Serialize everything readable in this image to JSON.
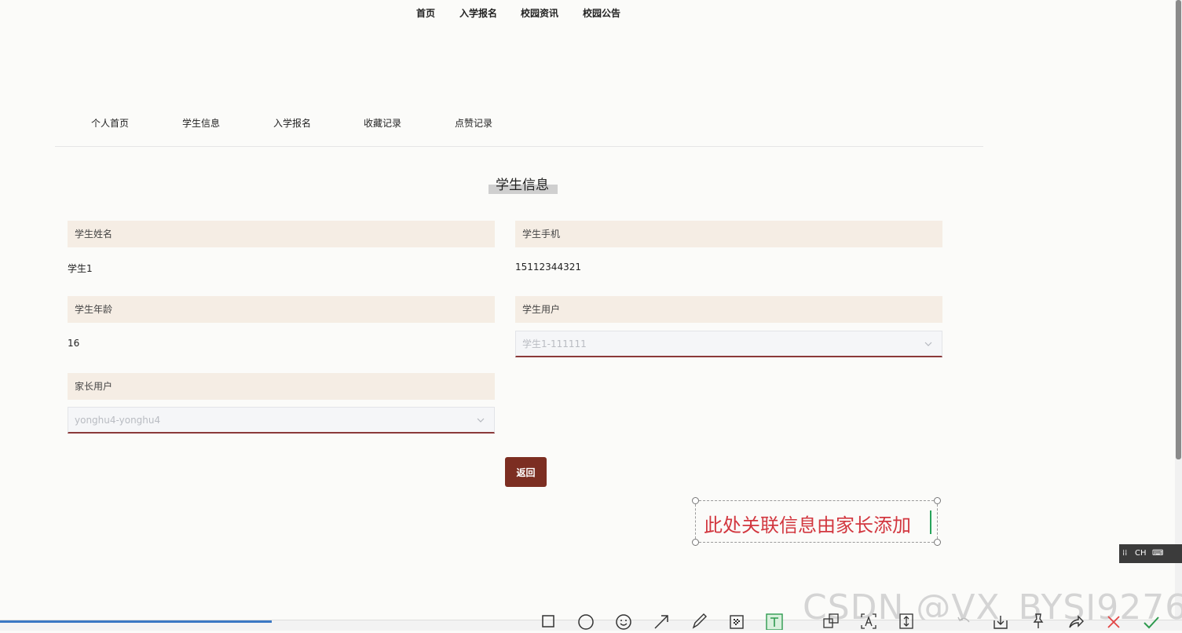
{
  "top_nav": {
    "items": [
      {
        "label": "首页"
      },
      {
        "label": "入学报名"
      },
      {
        "label": "校园资讯"
      },
      {
        "label": "校园公告"
      }
    ]
  },
  "sub_nav": {
    "items": [
      {
        "label": "个人首页"
      },
      {
        "label": "学生信息"
      },
      {
        "label": "入学报名"
      },
      {
        "label": "收藏记录"
      },
      {
        "label": "点赞记录"
      }
    ]
  },
  "page": {
    "title": "学生信息"
  },
  "form": {
    "student_name": {
      "label": "学生姓名",
      "value": "学生1"
    },
    "student_phone": {
      "label": "学生手机",
      "value": "15112344321"
    },
    "student_age": {
      "label": "学生年龄",
      "value": "16"
    },
    "student_user": {
      "label": "学生用户",
      "value": "学生1-111111"
    },
    "parent_user": {
      "label": "家长用户",
      "value": "yonghu4-yonghu4"
    },
    "back_label": "返回"
  },
  "annotation": {
    "text": "此处关联信息由家长添加",
    "text_color": "#d2373f"
  },
  "ime": {
    "label": "CH"
  },
  "watermark": {
    "text": "CSDN @VX_BYSJ9276"
  },
  "colors": {
    "accent": "#7c2e22",
    "label_bg": "#f5ede4",
    "select_underline": "#8b3a3a"
  }
}
